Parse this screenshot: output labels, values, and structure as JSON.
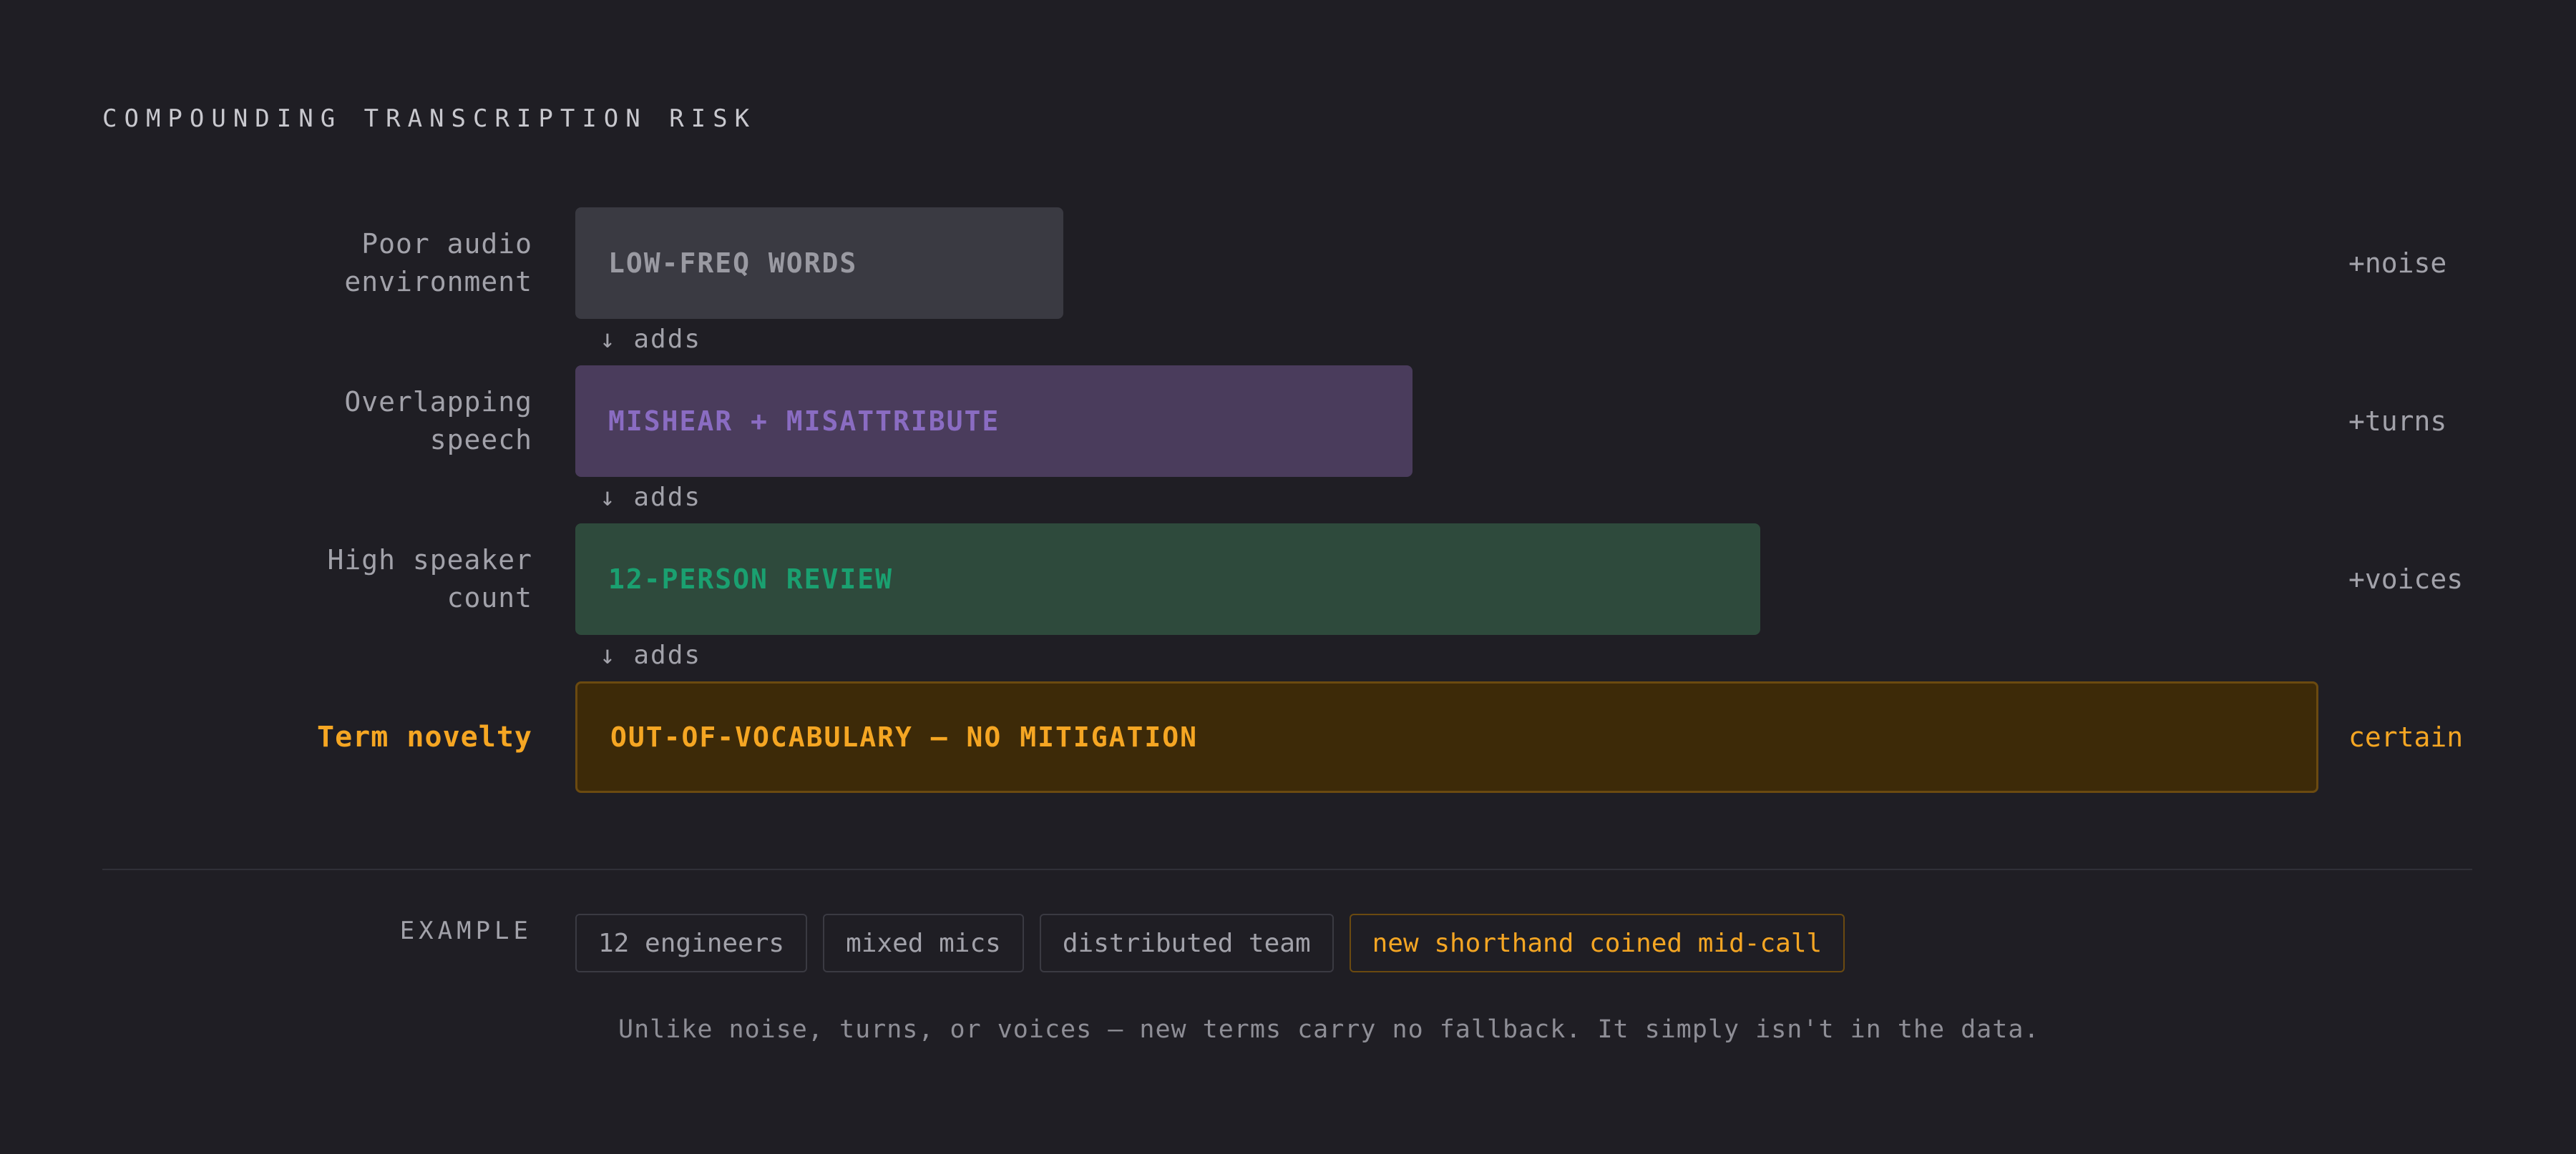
{
  "title": "COMPOUNDING TRANSCRIPTION RISK",
  "rows": [
    {
      "label_line1": "Poor audio",
      "label_line2": "environment",
      "bar": "LOW-FREQ WORDS",
      "tag": "+noise"
    },
    {
      "label_line1": "Overlapping",
      "label_line2": "speech",
      "bar": "MISHEAR + MISATTRIBUTE",
      "tag": "+turns"
    },
    {
      "label_line1": "High speaker",
      "label_line2": "count",
      "bar": "12-PERSON REVIEW",
      "tag": "+voices"
    },
    {
      "label_line1": "Term novelty",
      "label_line2": "",
      "bar": "OUT-OF-VOCABULARY — NO MITIGATION",
      "tag": "certain"
    }
  ],
  "connector_label": "↓ adds",
  "example": {
    "label": "EXAMPLE",
    "chips": [
      "12 engineers",
      "mixed mics",
      "distributed team",
      "new shorthand coined mid-call"
    ]
  },
  "footnote": "Unlike noise, turns, or voices — new terms carry no fallback. It simply isn't in the data.",
  "colors": {
    "background": "#1f1e24",
    "row1": "#3a3a42",
    "row2": "#4a3c5c",
    "row3": "#2e4a3c",
    "row4": "#3d2a08",
    "accent": "#f5a623"
  }
}
